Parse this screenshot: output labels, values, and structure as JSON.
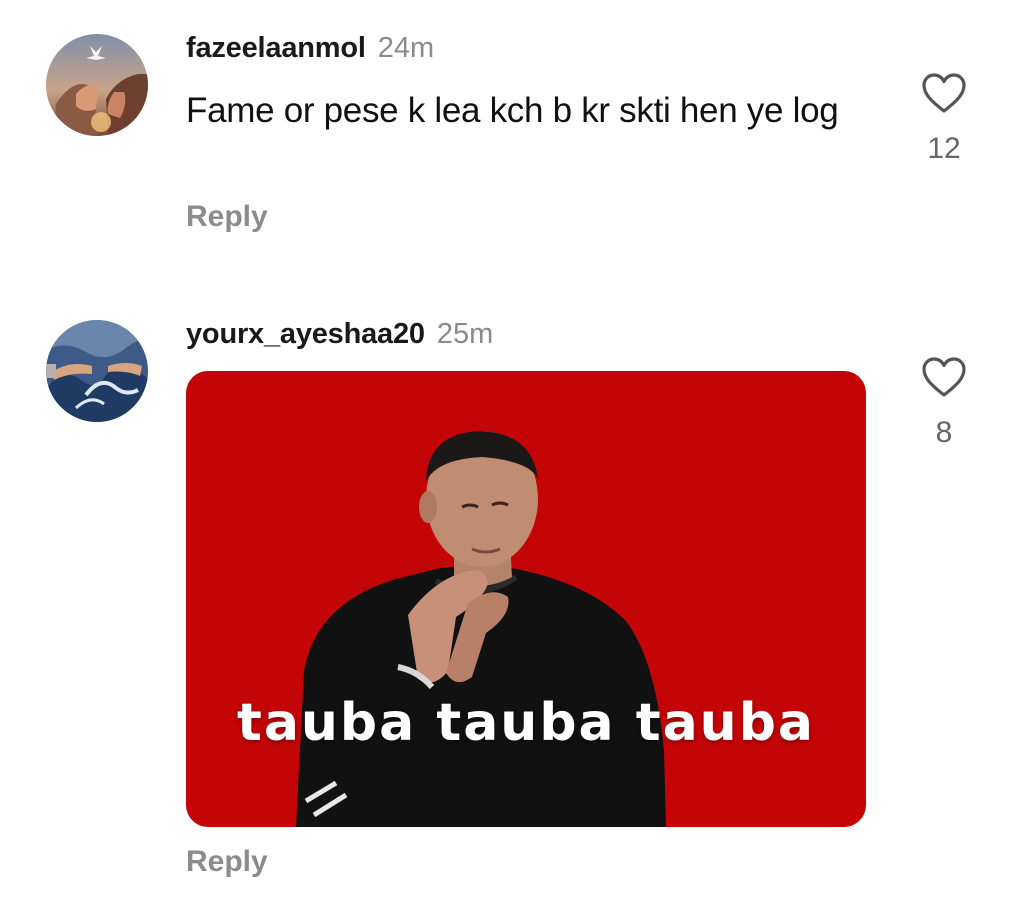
{
  "colors": {
    "background": "#ffffff",
    "username": "#1a1a1a",
    "timestamp": "#8a8a8a",
    "reply": "#8c8c8c",
    "like_count": "#666666",
    "gif_background": "#c40508"
  },
  "comments": [
    {
      "username": "fazeelaanmol",
      "time": "24m",
      "text": "Fame or pese k lea kch b kr skti hen ye log",
      "reply_label": "Reply",
      "like_icon": "heart-outline-icon",
      "like_count": "12"
    },
    {
      "username": "yourx_ayeshaa20",
      "time": "25m",
      "gif_caption": "tauba tauba tauba",
      "reply_label": "Reply",
      "like_icon": "heart-outline-icon",
      "like_count": "8"
    }
  ]
}
